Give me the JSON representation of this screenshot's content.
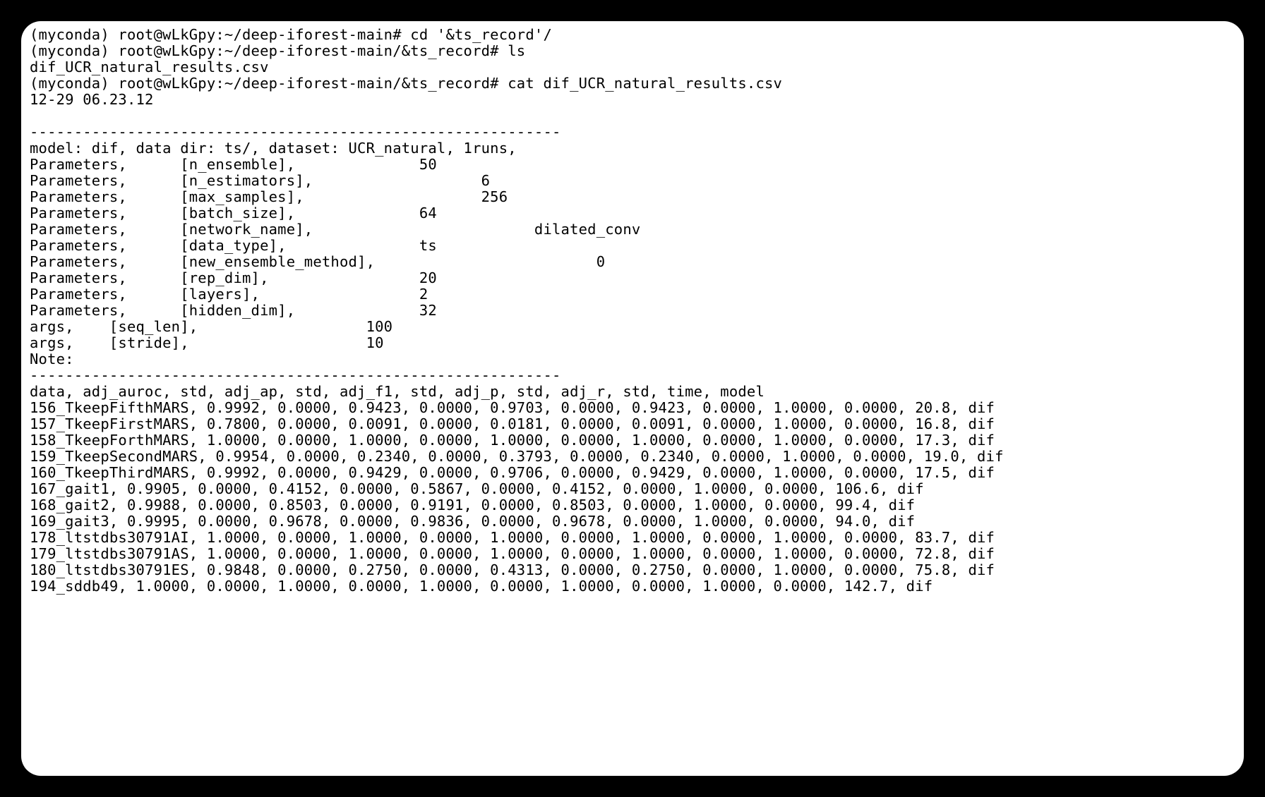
{
  "terminal": {
    "lines": [
      "(myconda) root@wLkGpy:~/deep-iforest-main# cd '&ts_record'/",
      "(myconda) root@wLkGpy:~/deep-iforest-main/&ts_record# ls",
      "dif_UCR_natural_results.csv",
      "(myconda) root@wLkGpy:~/deep-iforest-main/&ts_record# cat dif_UCR_natural_results.csv",
      "12-29 06.23.12",
      "",
      "------------------------------------------------------------",
      "model: dif, data dir: ts/, dataset: UCR_natural, 1runs,",
      "Parameters,      [n_ensemble],              50",
      "Parameters,      [n_estimators],                   6",
      "Parameters,      [max_samples],                    256",
      "Parameters,      [batch_size],              64",
      "Parameters,      [network_name],                         dilated_conv",
      "Parameters,      [data_type],               ts",
      "Parameters,      [new_ensemble_method],                         0",
      "Parameters,      [rep_dim],                 20",
      "Parameters,      [layers],                  2",
      "Parameters,      [hidden_dim],              32",
      "args,    [seq_len],                   100",
      "args,    [stride],                    10",
      "Note:",
      "------------------------------------------------------------",
      "data, adj_auroc, std, adj_ap, std, adj_f1, std, adj_p, std, adj_r, std, time, model",
      "156_TkeepFifthMARS, 0.9992, 0.0000, 0.9423, 0.0000, 0.9703, 0.0000, 0.9423, 0.0000, 1.0000, 0.0000, 20.8, dif",
      "157_TkeepFirstMARS, 0.7800, 0.0000, 0.0091, 0.0000, 0.0181, 0.0000, 0.0091, 0.0000, 1.0000, 0.0000, 16.8, dif",
      "158_TkeepForthMARS, 1.0000, 0.0000, 1.0000, 0.0000, 1.0000, 0.0000, 1.0000, 0.0000, 1.0000, 0.0000, 17.3, dif",
      "159_TkeepSecondMARS, 0.9954, 0.0000, 0.2340, 0.0000, 0.3793, 0.0000, 0.2340, 0.0000, 1.0000, 0.0000, 19.0, dif",
      "160_TkeepThirdMARS, 0.9992, 0.0000, 0.9429, 0.0000, 0.9706, 0.0000, 0.9429, 0.0000, 1.0000, 0.0000, 17.5, dif",
      "167_gait1, 0.9905, 0.0000, 0.4152, 0.0000, 0.5867, 0.0000, 0.4152, 0.0000, 1.0000, 0.0000, 106.6, dif",
      "168_gait2, 0.9988, 0.0000, 0.8503, 0.0000, 0.9191, 0.0000, 0.8503, 0.0000, 1.0000, 0.0000, 99.4, dif",
      "169_gait3, 0.9995, 0.0000, 0.9678, 0.0000, 0.9836, 0.0000, 0.9678, 0.0000, 1.0000, 0.0000, 94.0, dif",
      "178_ltstdbs30791AI, 1.0000, 0.0000, 1.0000, 0.0000, 1.0000, 0.0000, 1.0000, 0.0000, 1.0000, 0.0000, 83.7, dif",
      "179_ltstdbs30791AS, 1.0000, 0.0000, 1.0000, 0.0000, 1.0000, 0.0000, 1.0000, 0.0000, 1.0000, 0.0000, 72.8, dif",
      "180_ltstdbs30791ES, 0.9848, 0.0000, 0.2750, 0.0000, 0.4313, 0.0000, 0.2750, 0.0000, 1.0000, 0.0000, 75.8, dif",
      "194_sddb49, 1.0000, 0.0000, 1.0000, 0.0000, 1.0000, 0.0000, 1.0000, 0.0000, 1.0000, 0.0000, 142.7, dif"
    ]
  }
}
